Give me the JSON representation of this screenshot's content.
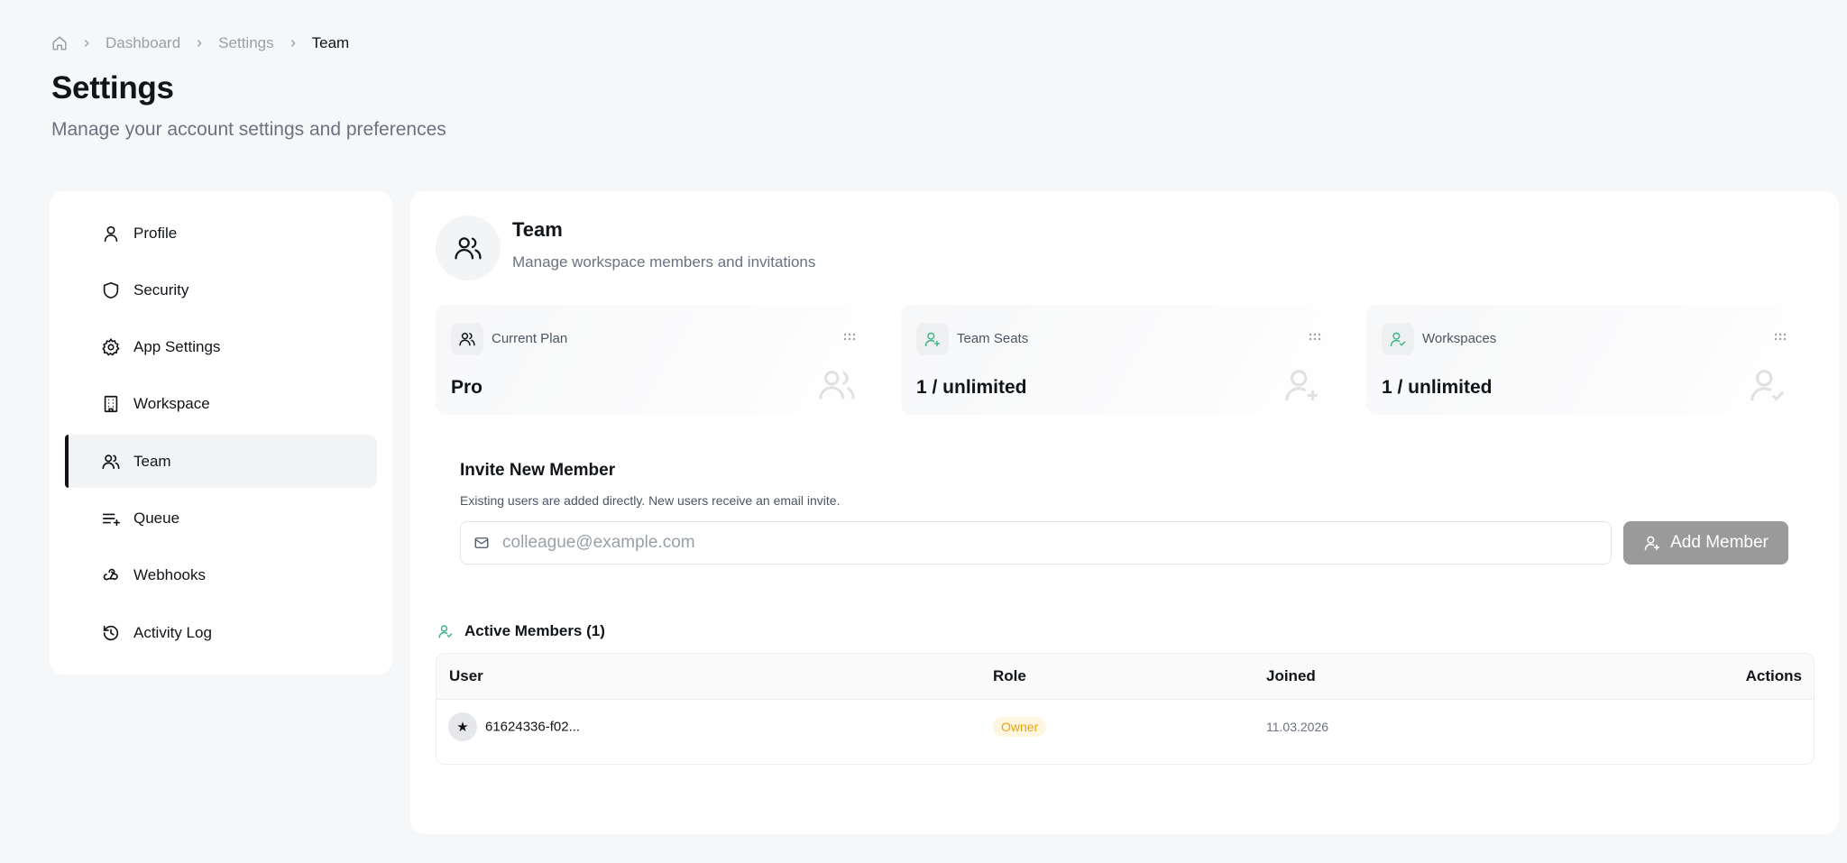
{
  "breadcrumb": {
    "items": [
      "Dashboard",
      "Settings"
    ],
    "current": "Team"
  },
  "header": {
    "title": "Settings",
    "subtitle": "Manage your account settings and preferences"
  },
  "sidebar": {
    "items": [
      {
        "label": "Profile",
        "icon": "user-icon"
      },
      {
        "label": "Security",
        "icon": "shield-icon"
      },
      {
        "label": "App Settings",
        "icon": "gear-icon"
      },
      {
        "label": "Workspace",
        "icon": "building-icon"
      },
      {
        "label": "Team",
        "icon": "users-icon",
        "active": true
      },
      {
        "label": "Queue",
        "icon": "queue-icon"
      },
      {
        "label": "Webhooks",
        "icon": "webhook-icon"
      },
      {
        "label": "Activity Log",
        "icon": "history-icon"
      }
    ]
  },
  "team": {
    "title": "Team",
    "subtitle": "Manage workspace members and invitations"
  },
  "stats": [
    {
      "label": "Current Plan",
      "value": "Pro",
      "icon": "users-icon"
    },
    {
      "label": "Team Seats",
      "value": "1 / unlimited",
      "icon": "user-plus-icon"
    },
    {
      "label": "Workspaces",
      "value": "1 / unlimited",
      "icon": "user-check-icon"
    }
  ],
  "invite": {
    "title": "Invite New Member",
    "subtitle": "Existing users are added directly. New users receive an email invite.",
    "placeholder": "colleague@example.com",
    "button": "Add Member"
  },
  "members": {
    "heading": "Active Members (1)",
    "columns": {
      "user": "User",
      "role": "Role",
      "joined": "Joined",
      "actions": "Actions"
    },
    "rows": [
      {
        "avatar": "★",
        "user": "61624336-f02...",
        "role": "Owner",
        "joined": "11.03.2026"
      }
    ]
  },
  "colors": {
    "accent": "#111418",
    "success": "#3fb68b",
    "owner_badge": "#e3a514",
    "button_disabled": "#9a9a9a"
  }
}
